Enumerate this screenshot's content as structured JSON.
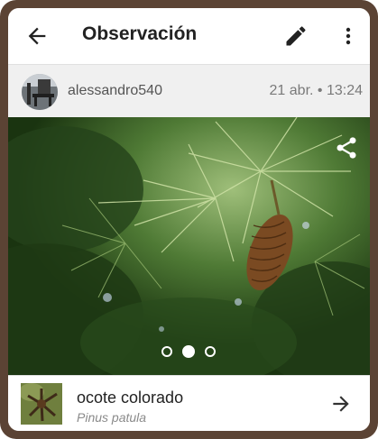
{
  "appbar": {
    "title": "Observación",
    "back_icon": "arrow-left-icon",
    "edit_icon": "pencil-icon",
    "more_icon": "more-vert-icon"
  },
  "observer": {
    "username": "alessandro540",
    "datetime": "21 abr. • 13:24"
  },
  "photo": {
    "share_icon": "share-icon",
    "pager": {
      "count": 3,
      "active_index": 1
    }
  },
  "taxon": {
    "common_name": "ocote colorado",
    "scientific_name": "Pinus patula",
    "arrow_icon": "arrow-right-icon"
  },
  "colors": {
    "frame": "#5b4334",
    "header_bg": "#ffffff",
    "userbar_bg": "#f0f0f0",
    "text_primary": "#222222",
    "text_secondary": "#8a8a8a"
  }
}
